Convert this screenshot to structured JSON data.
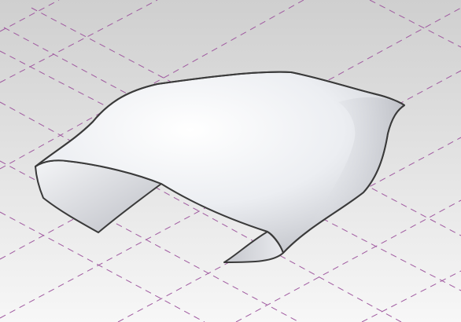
{
  "viewport": {
    "background_top": "#cfcfcf",
    "background_bottom": "#f7f7f7",
    "grid_line_color": "#a05aa0",
    "grid_line_style": "dashed",
    "grid_visible": true
  },
  "model": {
    "object_type": "curved surface",
    "surface_fill_light": "#ffffff",
    "surface_fill_mid": "#e4e6eb",
    "surface_fill_dark": "#a9abb2",
    "edge_color": "#3a3a3a"
  }
}
